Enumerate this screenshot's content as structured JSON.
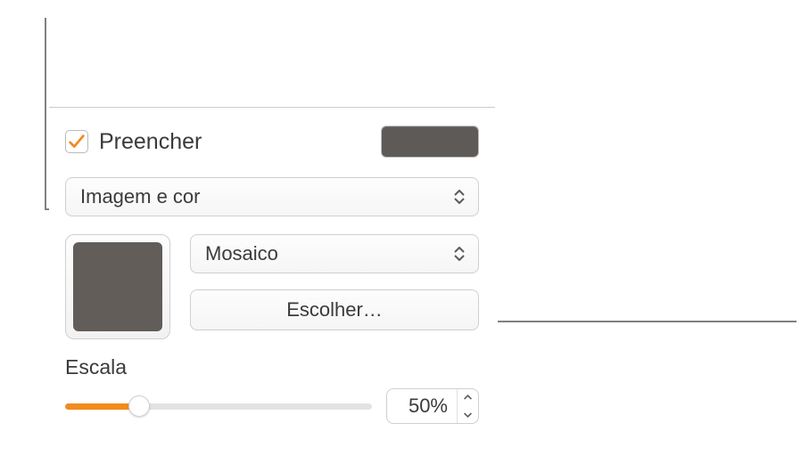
{
  "fill": {
    "checkbox_label": "Preencher",
    "checked": true,
    "color_well": "#5e5a57",
    "type_label": "Imagem e cor",
    "scaling_label": "Mosaico",
    "choose_label": "Escolher…",
    "image_thumb_color": "#625d59"
  },
  "scale": {
    "label": "Escala",
    "value_text": "50%",
    "percent": 50,
    "slider_fill_percent": 24
  },
  "colors": {
    "accent": "#f28a1c"
  }
}
